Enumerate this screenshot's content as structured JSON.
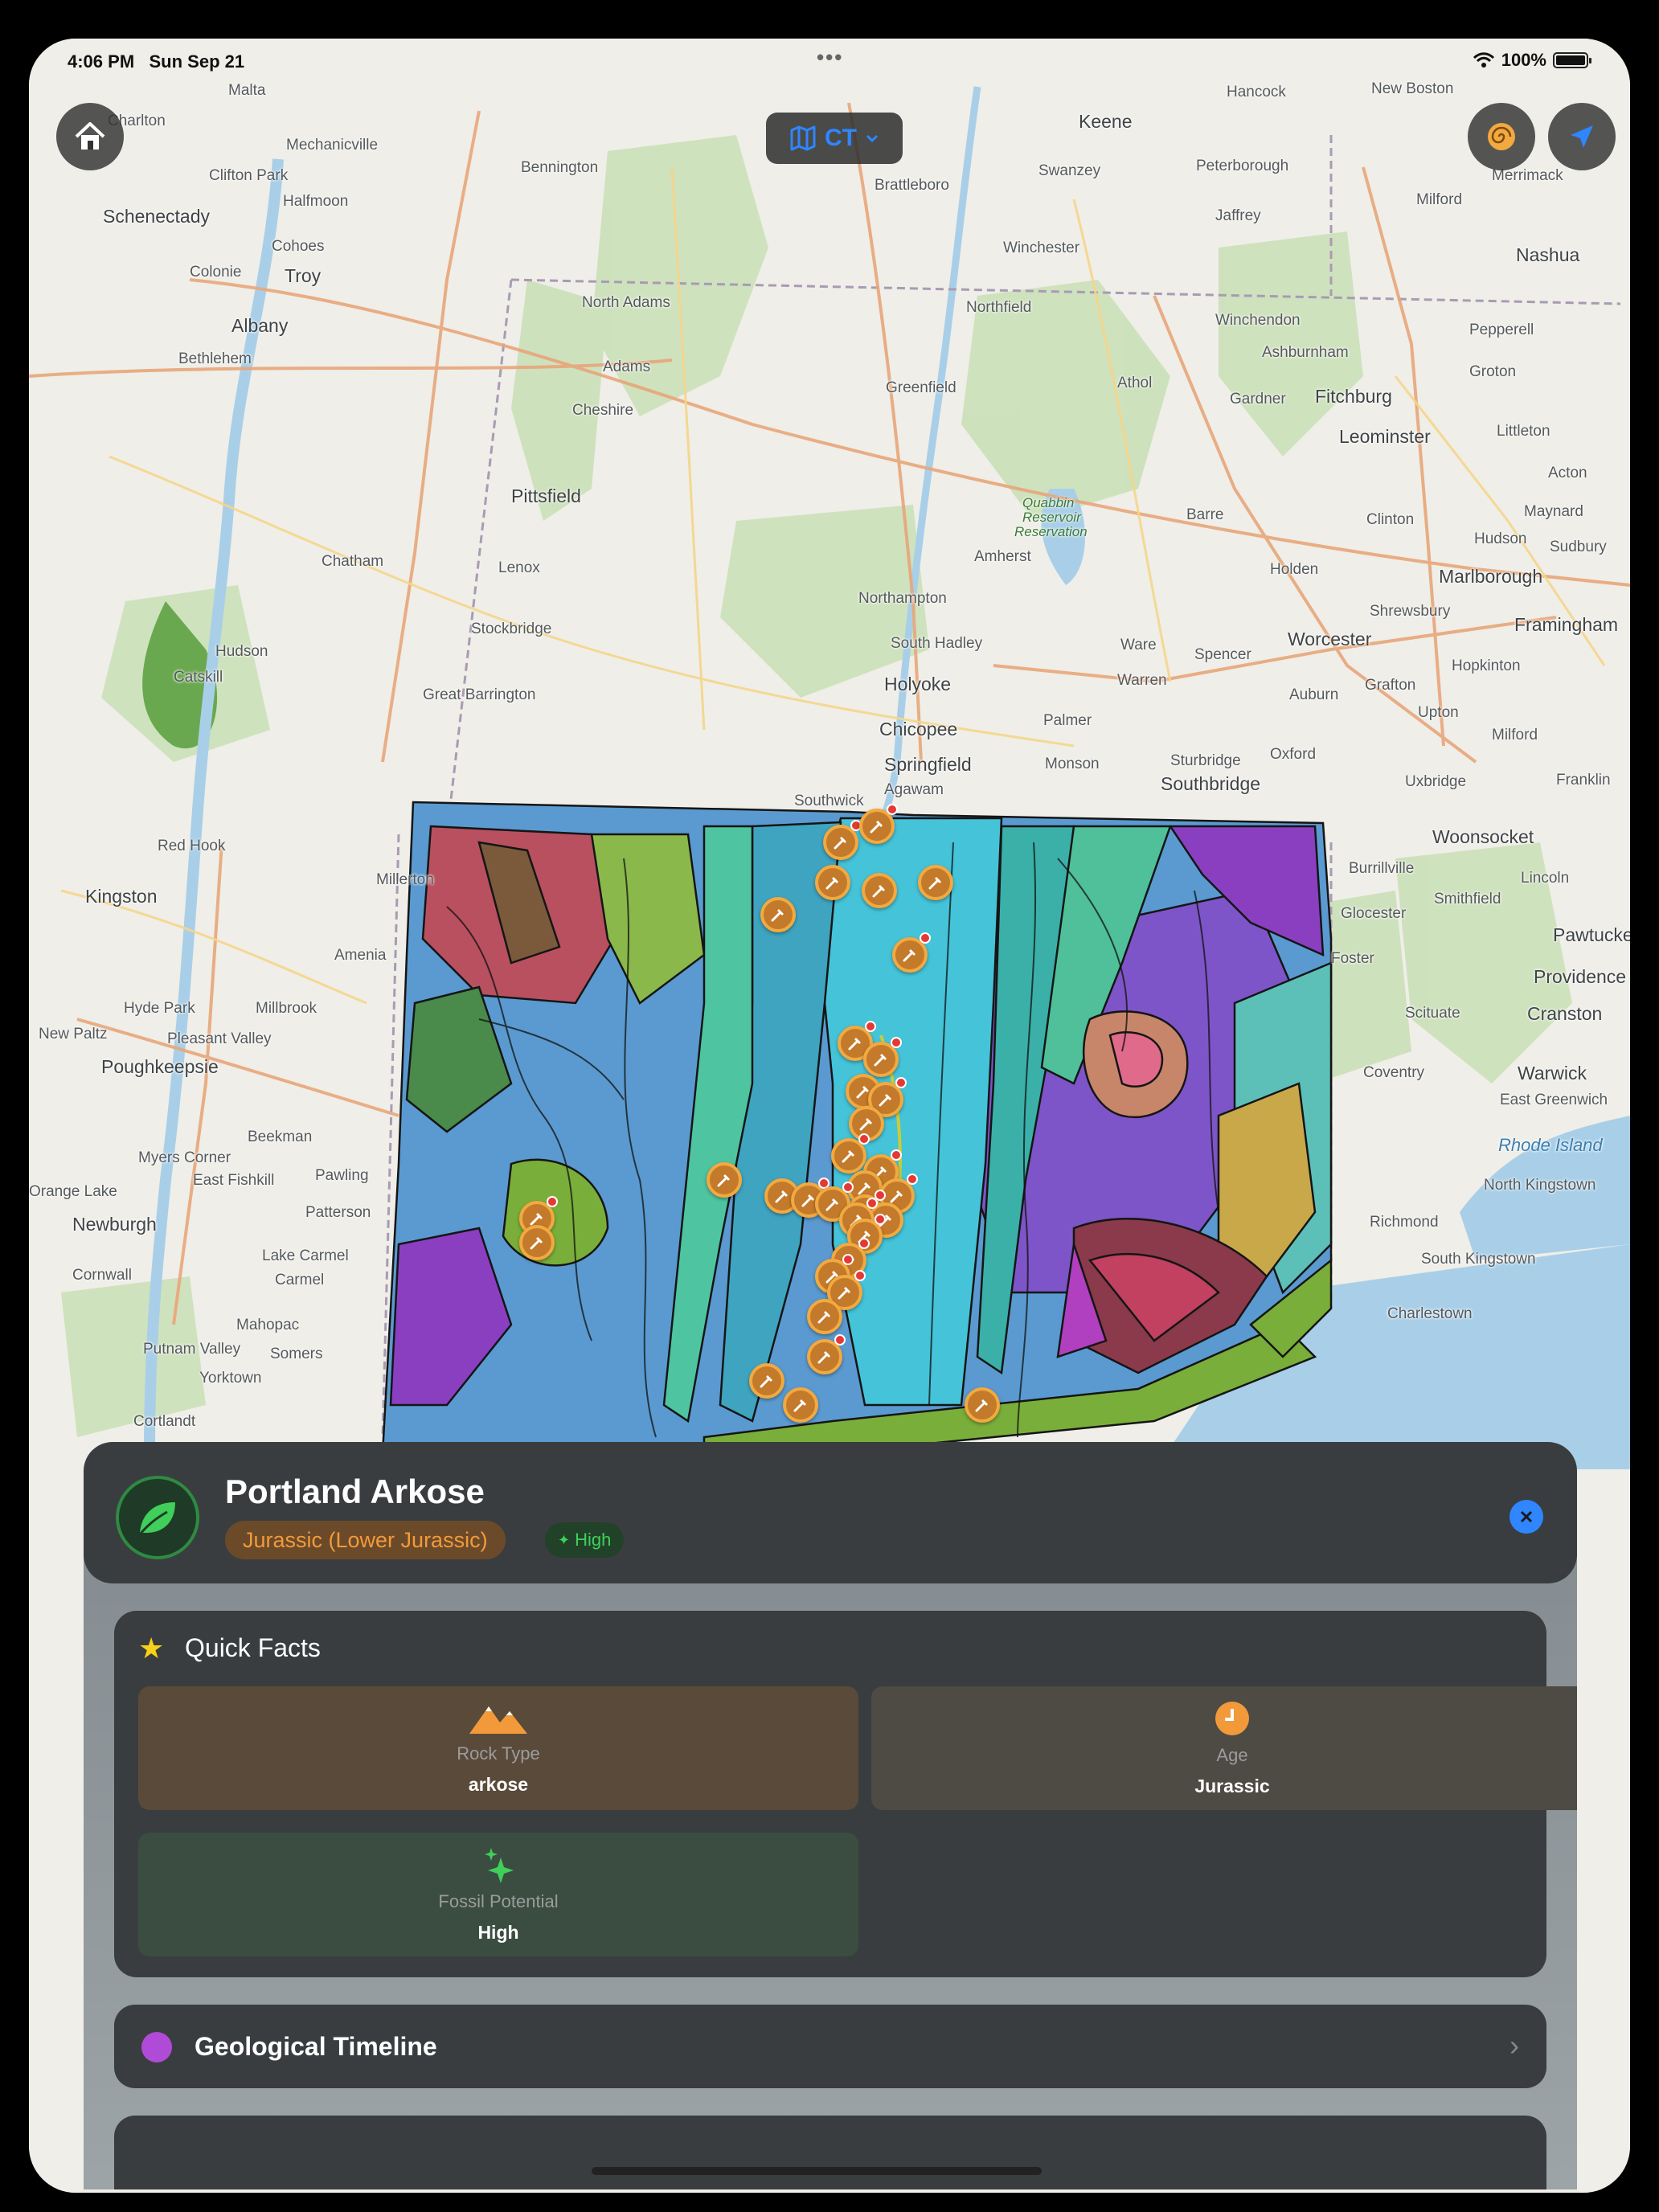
{
  "status_bar": {
    "time": "4:06 PM",
    "date": "Sun Sep 21",
    "battery": "100%"
  },
  "map": {
    "region_button_label": "CT",
    "places": [
      "Malta",
      "Charlton",
      "Mechanicville",
      "Clifton Park",
      "Halfmoon",
      "Schenectady",
      "Cohoes",
      "Colonie",
      "Troy",
      "Albany",
      "Bethlehem",
      "Bennington",
      "North Adams",
      "Adams",
      "Cheshire",
      "Pittsfield",
      "Lenox",
      "Stockbridge",
      "Great Barrington",
      "Chatham",
      "Hudson",
      "Catskill",
      "Keene",
      "Swanzey",
      "Brattleboro",
      "Winchester",
      "Northfield",
      "Greenfield",
      "Amherst",
      "Northampton",
      "South Hadley",
      "Holyoke",
      "Chicopee",
      "Springfield",
      "Agawam",
      "Southwick",
      "Palmer",
      "Monson",
      "Ware",
      "Warren",
      "Barre",
      "Athol",
      "Gardner",
      "Fitchburg",
      "Leominster",
      "Winchendon",
      "Ashburnham",
      "Jaffrey",
      "Peterborough",
      "Hancock",
      "New Boston",
      "Milford",
      "Nashua",
      "Merrimack",
      "Pepperell",
      "Groton",
      "Littleton",
      "Acton",
      "Maynard",
      "Hudson",
      "Sudbury",
      "Marlborough",
      "Clinton",
      "Holden",
      "Shrewsbury",
      "Worcester",
      "Framingham",
      "Spencer",
      "Auburn",
      "Grafton",
      "Hopkinton",
      "Upton",
      "Milford",
      "Oxford",
      "Sturbridge",
      "Southbridge",
      "Uxbridge",
      "Franklin",
      "Woonsocket",
      "Burrillville",
      "Smithfield",
      "Glocester",
      "Lincoln",
      "Pawtucket",
      "Providence",
      "Foster",
      "Scituate",
      "Cranston",
      "Warwick",
      "Coventry",
      "East Greenwich",
      "Rhode Island",
      "North Kingstown",
      "Richmond",
      "South Kingstown",
      "Charlestown",
      "Red Hook",
      "Kingston",
      "Hyde Park",
      "Millbrook",
      "Amenia",
      "New Paltz",
      "Pleasant Valley",
      "Poughkeepsie",
      "Beekman",
      "Myers Corner",
      "East Fishkill",
      "Pawling",
      "Patterson",
      "Newburgh",
      "Lake Carmel",
      "Carmel",
      "Mahopac",
      "Putnam Valley",
      "Somers",
      "Yorktown",
      "Cortlandt",
      "Cornwall",
      "Orange Lake",
      "Troy",
      "Millerton",
      "Quabbin Reservoir",
      "Reservation"
    ],
    "markers_count": 40
  },
  "detail": {
    "title": "Portland Arkose",
    "era_chip": "Jurassic (Lower Jurassic)",
    "fossil_chip": "High",
    "quick_facts_title": "Quick Facts",
    "facts": [
      {
        "label": "Rock Type",
        "value": "arkose",
        "icon": "mountains-icon",
        "color": "#5a4a3a"
      },
      {
        "label": "Age",
        "value": "Jurassic",
        "icon": "clock-icon",
        "color": "#4e4a44"
      },
      {
        "label": "Fossil Potential",
        "value": "High",
        "icon": "sparkles-icon",
        "color": "#3a4d40"
      }
    ],
    "timeline_label": "Geological Timeline"
  },
  "colors": {
    "accent": "#2f86ff",
    "orange": "#f29a3a",
    "green": "#3fcf5a"
  }
}
